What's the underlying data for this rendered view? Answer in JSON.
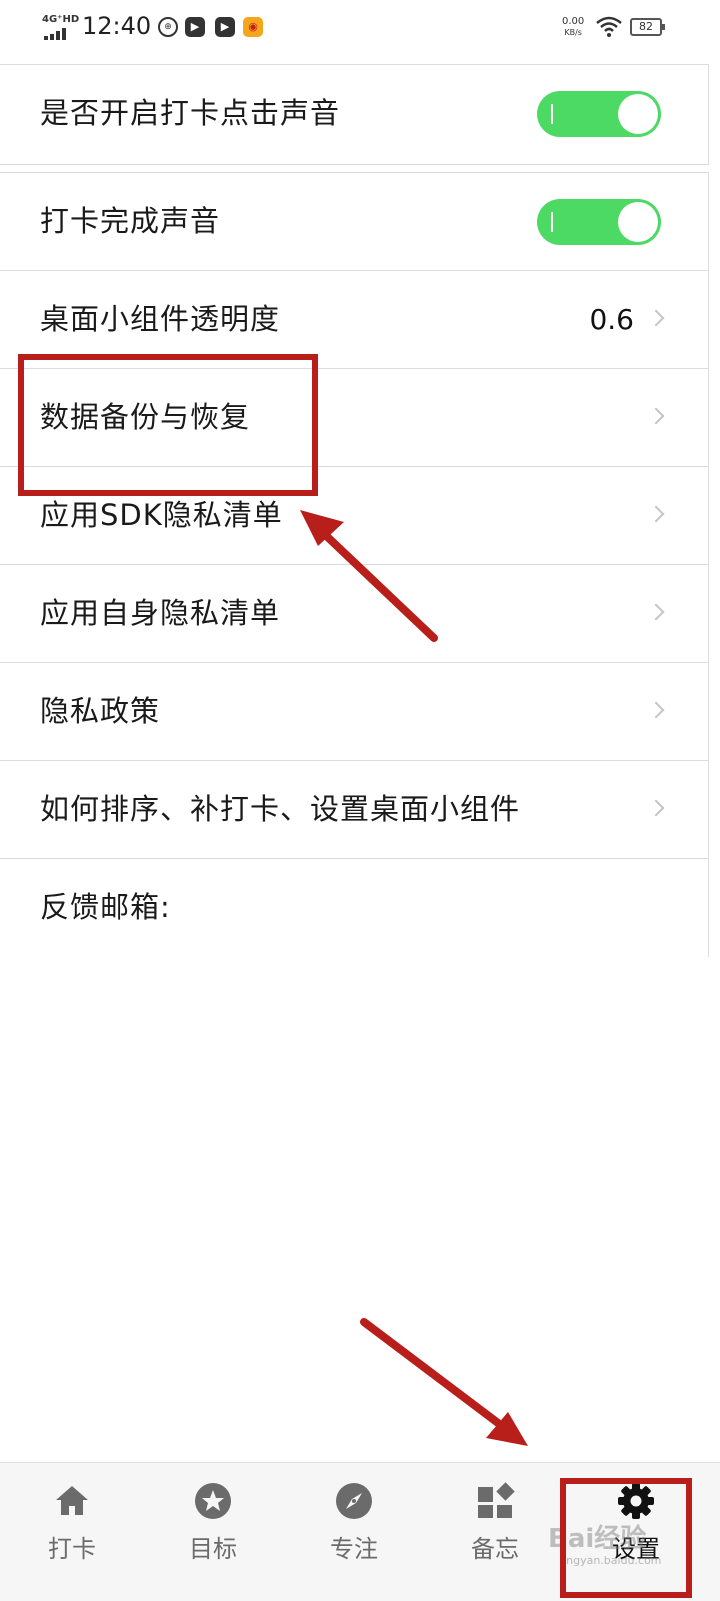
{
  "status_bar": {
    "network": "4G⁺HD",
    "time": "12:40",
    "net_speed_value": "0.00",
    "net_speed_unit": "KB/s",
    "battery": "82"
  },
  "settings": {
    "sound_toggle_label": "是否开启打卡点击声音",
    "sound_toggle_on": true,
    "complete_sound_label": "打卡完成声音",
    "complete_sound_on": true,
    "rows": [
      {
        "label": "桌面小组件透明度",
        "value": "0.6"
      },
      {
        "label": "数据备份与恢复"
      },
      {
        "label": "应用SDK隐私清单"
      },
      {
        "label": "应用自身隐私清单"
      },
      {
        "label": "隐私政策"
      },
      {
        "label": "如何排序、补打卡、设置桌面小组件"
      },
      {
        "label": "反馈邮箱:"
      }
    ]
  },
  "tabbar": {
    "tabs": [
      {
        "label": "打卡",
        "icon": "home-icon"
      },
      {
        "label": "目标",
        "icon": "star-icon"
      },
      {
        "label": "专注",
        "icon": "compass-icon"
      },
      {
        "label": "备忘",
        "icon": "widgets-icon"
      },
      {
        "label": "设置",
        "icon": "gear-icon",
        "active": true
      }
    ]
  },
  "annotations": {
    "color": "#b81e1a"
  },
  "watermark": {
    "text": "Bai经验",
    "url": "jingyan.baidu.com"
  },
  "colors": {
    "toggle_on": "#4cd964",
    "divider": "#dcdcdc"
  }
}
